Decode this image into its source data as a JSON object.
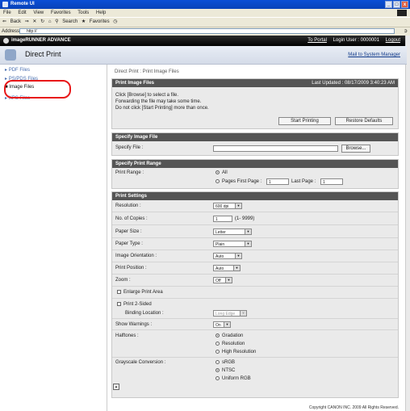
{
  "window": {
    "title": "Remote UI",
    "minimize": "_",
    "maximize": "□",
    "close": "x"
  },
  "menubar": {
    "items": [
      "File",
      "Edit",
      "View",
      "Favorites",
      "Tools",
      "Help"
    ]
  },
  "toolbar": {
    "back": "Back",
    "search": "Search",
    "favorites": "Favorites"
  },
  "addressbar": {
    "label": "Address",
    "url": "http://",
    "go_icon": "go-icon"
  },
  "header": {
    "brand": "imageRUNNER ADVANCE",
    "portal": "To Portal",
    "login": "Login User : 0000001",
    "logout": "Logout"
  },
  "subheader": {
    "title": "Direct Print",
    "mail": "Mail to System Manager"
  },
  "sidebar": {
    "items": [
      {
        "label": "PDF Files"
      },
      {
        "label": "PS/PDS Files"
      },
      {
        "label": "Image Files"
      },
      {
        "label": "XPS Files"
      }
    ]
  },
  "breadcrumb": "Direct Print : Print Image Files",
  "print_image": {
    "title": "Print Image Files",
    "updated": "Last Updated : 08/17/2009 3:40:23 AM",
    "instructions": [
      "Click [Browse] to select a file.",
      "Forwarding the file may take some time.",
      "Do not click [Start Printing] more than once."
    ],
    "start": "Start Printing",
    "restore": "Restore Defaults"
  },
  "specify_file": {
    "title": "Specify Image File",
    "label": "Specify File :",
    "browse": "Browse..."
  },
  "range": {
    "title": "Specify Print Range",
    "label": "Print Range :",
    "all": "All",
    "pages": "Pages First Page :",
    "first": "1",
    "last_label": "Last Page :",
    "last": "1"
  },
  "settings": {
    "title": "Print Settings",
    "resolution": {
      "label": "Resolution :",
      "value": "600 dpi"
    },
    "copies": {
      "label": "No. of Copies :",
      "value": "1",
      "hint": "(1- 9999)"
    },
    "paper_size": {
      "label": "Paper Size :",
      "value": "Letter"
    },
    "paper_type": {
      "label": "Paper Type :",
      "value": "Plain"
    },
    "orientation": {
      "label": "Image Orientation :",
      "value": "Auto"
    },
    "position": {
      "label": "Print Position :",
      "value": "Auto"
    },
    "zoom": {
      "label": "Zoom :",
      "value": "Off"
    },
    "enlarge": "Enlarge Print Area",
    "two_sided": "Print 2-Sided",
    "binding": {
      "label": "Binding Location :",
      "value": "Long Edge"
    },
    "warnings": {
      "label": "Show Warnings :",
      "value": "On"
    },
    "halftones": {
      "label": "Halftones :",
      "options": [
        "Gradation",
        "Resolution",
        "High Resolution"
      ]
    },
    "grayscale": {
      "label": "Grayscale Conversion :",
      "options": [
        "sRGB",
        "NTSC",
        "Uniform RGB"
      ]
    }
  },
  "footer": "Copyright CANON INC. 2009 All Rights Reserved."
}
